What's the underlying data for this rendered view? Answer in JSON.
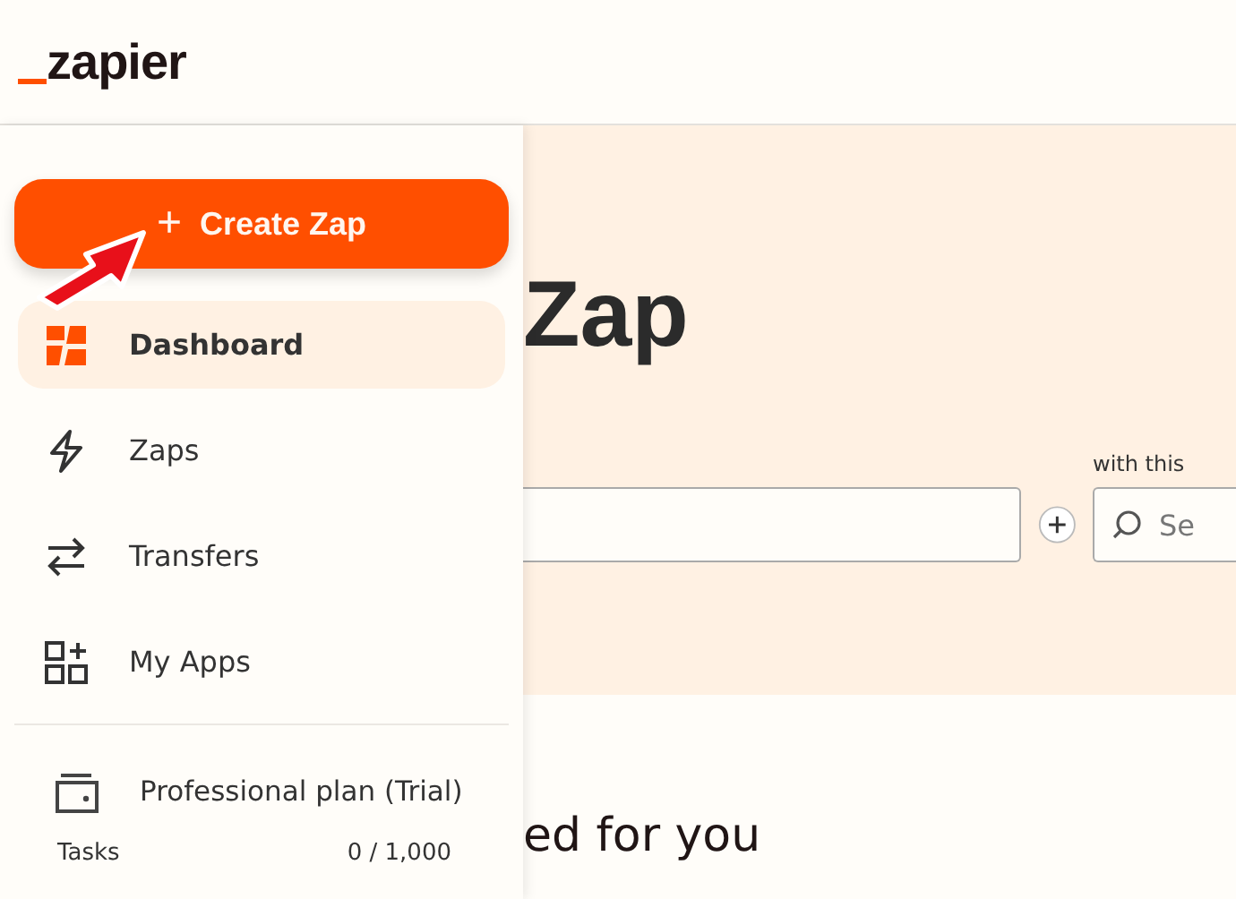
{
  "header": {
    "logo": "zapier"
  },
  "sidebar": {
    "create_button": {
      "label": "Create Zap",
      "icon": "+"
    },
    "items": [
      {
        "label": "Dashboard",
        "kind": "dashboard",
        "selected": true
      },
      {
        "label": "Zaps",
        "kind": "zaps",
        "selected": false
      },
      {
        "label": "Transfers",
        "kind": "transfers",
        "selected": false
      },
      {
        "label": "My Apps",
        "kind": "apps",
        "selected": false
      }
    ],
    "plan": {
      "label": "Professional plan (Trial)"
    },
    "tasks": {
      "label": "Tasks",
      "value": "0 / 1,000"
    }
  },
  "main": {
    "title": "Zap",
    "with_label": "with this",
    "search": {
      "placeholder": "Se"
    },
    "section_title": "ed for you"
  }
}
